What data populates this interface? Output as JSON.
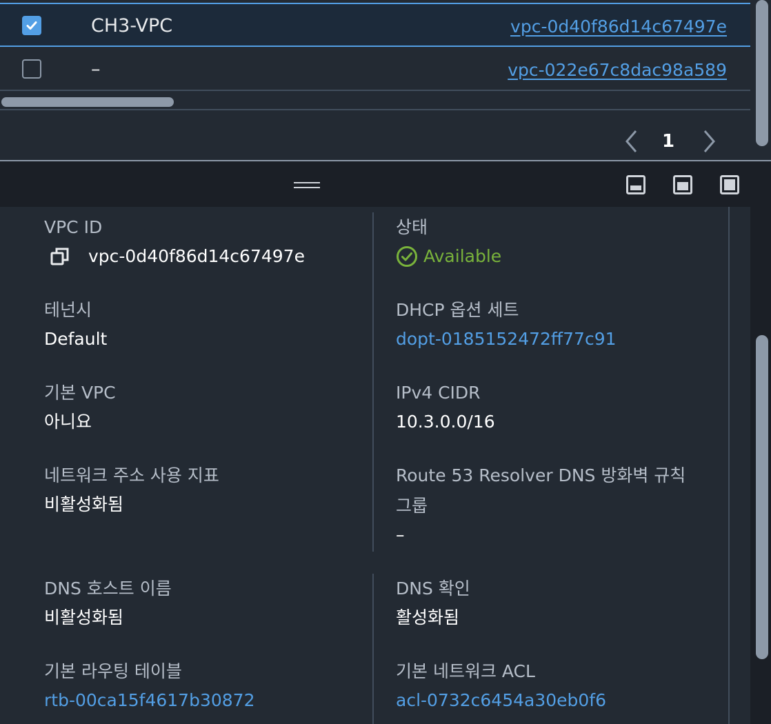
{
  "table": {
    "rows": [
      {
        "name": "CH3-VPC",
        "vpc_id": "vpc-0d40f86d14c67497e",
        "selected": true
      },
      {
        "name": "–",
        "vpc_id": "vpc-022e67c8dac98a589",
        "selected": false
      }
    ],
    "pagination": {
      "current_page": "1"
    }
  },
  "details": {
    "vpc_id": {
      "label": "VPC ID",
      "value": "vpc-0d40f86d14c67497e"
    },
    "state": {
      "label": "상태",
      "value": "Available"
    },
    "tenancy": {
      "label": "테넌시",
      "value": "Default"
    },
    "dhcp": {
      "label": "DHCP 옵션 세트",
      "value": "dopt-0185152472ff77c91"
    },
    "default_vpc": {
      "label": "기본 VPC",
      "value": "아니요"
    },
    "ipv4_cidr": {
      "label": "IPv4 CIDR",
      "value": "10.3.0.0/16"
    },
    "network_metrics": {
      "label": "네트워크 주소 사용 지표",
      "value": "비활성화됨"
    },
    "route53": {
      "label_line1": "Route 53 Resolver DNS 방화벽 규칙",
      "label_line2": "그룹",
      "value": "–"
    },
    "dns_hostnames": {
      "label": "DNS 호스트 이름",
      "value": "비활성화됨"
    },
    "dns_resolution": {
      "label": "DNS 확인",
      "value": "활성화됨"
    },
    "main_route_table": {
      "label": "기본 라우팅 테이블",
      "value": "rtb-00ca15f4617b30872"
    },
    "main_network_acl": {
      "label": "기본 네트워크 ACL",
      "value": "acl-0732c6454a30eb0f6"
    }
  },
  "colors": {
    "accent": "#539fe5",
    "success": "#79b33b",
    "background": "#232a33"
  },
  "icons": {
    "checkbox_checked": "check-icon",
    "copy": "copy-icon",
    "status": "check-circle-icon",
    "prev": "chevron-left-icon",
    "next": "chevron-right-icon",
    "drag": "drag-handle-icon",
    "layouts": [
      "panel-bottom-icon",
      "panel-middle-icon",
      "panel-full-icon"
    ]
  }
}
